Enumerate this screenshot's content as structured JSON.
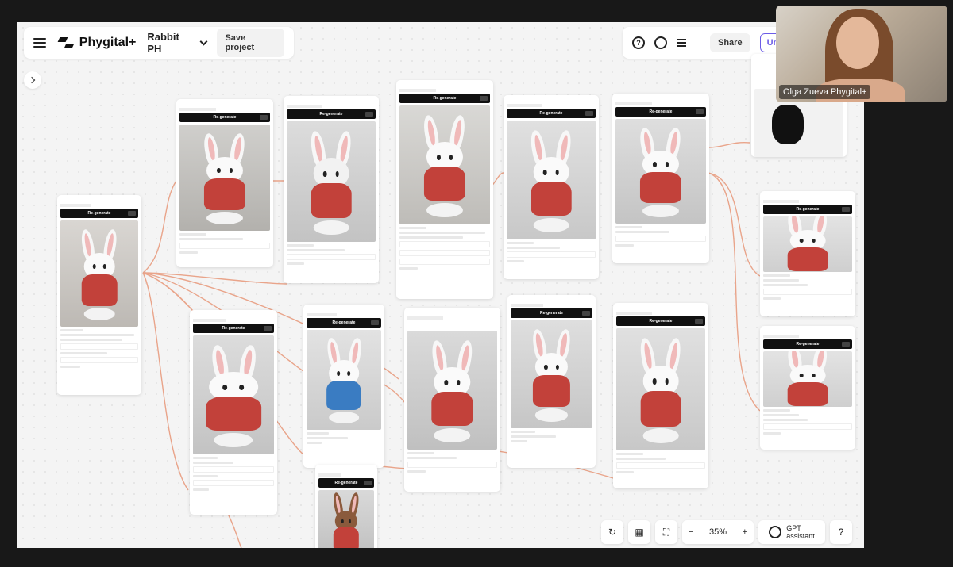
{
  "app": {
    "brand": "Phygital+",
    "project_name": "Rabbit PH",
    "save_label": "Save project"
  },
  "header_right": {
    "help_icon": "?",
    "share_label": "Share",
    "unlimited_label": "Unlim"
  },
  "node_common": {
    "regen_label": "Re-generate"
  },
  "webcam": {
    "name": "Olga Zueva Phygital+"
  },
  "bottom": {
    "zoom_value": "35%",
    "zoom_minus": "−",
    "zoom_plus": "+",
    "gpt_line1": "GPT",
    "gpt_line2": "assistant",
    "help": "?"
  },
  "colors": {
    "vest_red": "#c2413a",
    "vest_blue": "#3a7cc2",
    "bunny_brown": "#8a5a3c",
    "wire": "#e9a48a",
    "accent": "#6c5ce7"
  }
}
